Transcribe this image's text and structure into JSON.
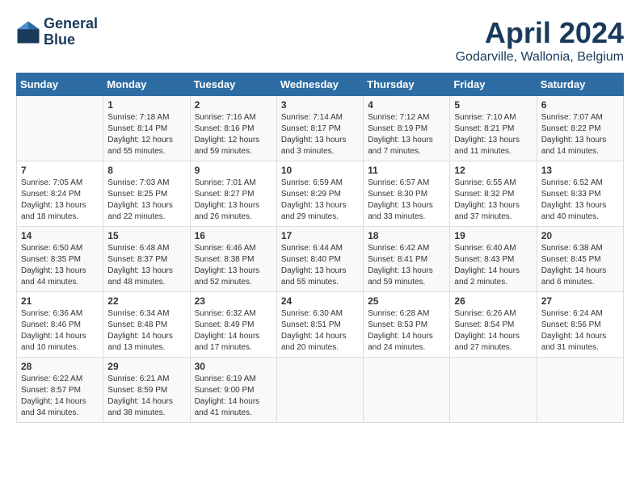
{
  "header": {
    "logo_line1": "General",
    "logo_line2": "Blue",
    "title": "April 2024",
    "subtitle": "Godarville, Wallonia, Belgium"
  },
  "days_of_week": [
    "Sunday",
    "Monday",
    "Tuesday",
    "Wednesday",
    "Thursday",
    "Friday",
    "Saturday"
  ],
  "weeks": [
    [
      {
        "day": "",
        "sunrise": "",
        "sunset": "",
        "daylight": ""
      },
      {
        "day": "1",
        "sunrise": "Sunrise: 7:18 AM",
        "sunset": "Sunset: 8:14 PM",
        "daylight": "Daylight: 12 hours and 55 minutes."
      },
      {
        "day": "2",
        "sunrise": "Sunrise: 7:16 AM",
        "sunset": "Sunset: 8:16 PM",
        "daylight": "Daylight: 12 hours and 59 minutes."
      },
      {
        "day": "3",
        "sunrise": "Sunrise: 7:14 AM",
        "sunset": "Sunset: 8:17 PM",
        "daylight": "Daylight: 13 hours and 3 minutes."
      },
      {
        "day": "4",
        "sunrise": "Sunrise: 7:12 AM",
        "sunset": "Sunset: 8:19 PM",
        "daylight": "Daylight: 13 hours and 7 minutes."
      },
      {
        "day": "5",
        "sunrise": "Sunrise: 7:10 AM",
        "sunset": "Sunset: 8:21 PM",
        "daylight": "Daylight: 13 hours and 11 minutes."
      },
      {
        "day": "6",
        "sunrise": "Sunrise: 7:07 AM",
        "sunset": "Sunset: 8:22 PM",
        "daylight": "Daylight: 13 hours and 14 minutes."
      }
    ],
    [
      {
        "day": "7",
        "sunrise": "Sunrise: 7:05 AM",
        "sunset": "Sunset: 8:24 PM",
        "daylight": "Daylight: 13 hours and 18 minutes."
      },
      {
        "day": "8",
        "sunrise": "Sunrise: 7:03 AM",
        "sunset": "Sunset: 8:25 PM",
        "daylight": "Daylight: 13 hours and 22 minutes."
      },
      {
        "day": "9",
        "sunrise": "Sunrise: 7:01 AM",
        "sunset": "Sunset: 8:27 PM",
        "daylight": "Daylight: 13 hours and 26 minutes."
      },
      {
        "day": "10",
        "sunrise": "Sunrise: 6:59 AM",
        "sunset": "Sunset: 8:29 PM",
        "daylight": "Daylight: 13 hours and 29 minutes."
      },
      {
        "day": "11",
        "sunrise": "Sunrise: 6:57 AM",
        "sunset": "Sunset: 8:30 PM",
        "daylight": "Daylight: 13 hours and 33 minutes."
      },
      {
        "day": "12",
        "sunrise": "Sunrise: 6:55 AM",
        "sunset": "Sunset: 8:32 PM",
        "daylight": "Daylight: 13 hours and 37 minutes."
      },
      {
        "day": "13",
        "sunrise": "Sunrise: 6:52 AM",
        "sunset": "Sunset: 8:33 PM",
        "daylight": "Daylight: 13 hours and 40 minutes."
      }
    ],
    [
      {
        "day": "14",
        "sunrise": "Sunrise: 6:50 AM",
        "sunset": "Sunset: 8:35 PM",
        "daylight": "Daylight: 13 hours and 44 minutes."
      },
      {
        "day": "15",
        "sunrise": "Sunrise: 6:48 AM",
        "sunset": "Sunset: 8:37 PM",
        "daylight": "Daylight: 13 hours and 48 minutes."
      },
      {
        "day": "16",
        "sunrise": "Sunrise: 6:46 AM",
        "sunset": "Sunset: 8:38 PM",
        "daylight": "Daylight: 13 hours and 52 minutes."
      },
      {
        "day": "17",
        "sunrise": "Sunrise: 6:44 AM",
        "sunset": "Sunset: 8:40 PM",
        "daylight": "Daylight: 13 hours and 55 minutes."
      },
      {
        "day": "18",
        "sunrise": "Sunrise: 6:42 AM",
        "sunset": "Sunset: 8:41 PM",
        "daylight": "Daylight: 13 hours and 59 minutes."
      },
      {
        "day": "19",
        "sunrise": "Sunrise: 6:40 AM",
        "sunset": "Sunset: 8:43 PM",
        "daylight": "Daylight: 14 hours and 2 minutes."
      },
      {
        "day": "20",
        "sunrise": "Sunrise: 6:38 AM",
        "sunset": "Sunset: 8:45 PM",
        "daylight": "Daylight: 14 hours and 6 minutes."
      }
    ],
    [
      {
        "day": "21",
        "sunrise": "Sunrise: 6:36 AM",
        "sunset": "Sunset: 8:46 PM",
        "daylight": "Daylight: 14 hours and 10 minutes."
      },
      {
        "day": "22",
        "sunrise": "Sunrise: 6:34 AM",
        "sunset": "Sunset: 8:48 PM",
        "daylight": "Daylight: 14 hours and 13 minutes."
      },
      {
        "day": "23",
        "sunrise": "Sunrise: 6:32 AM",
        "sunset": "Sunset: 8:49 PM",
        "daylight": "Daylight: 14 hours and 17 minutes."
      },
      {
        "day": "24",
        "sunrise": "Sunrise: 6:30 AM",
        "sunset": "Sunset: 8:51 PM",
        "daylight": "Daylight: 14 hours and 20 minutes."
      },
      {
        "day": "25",
        "sunrise": "Sunrise: 6:28 AM",
        "sunset": "Sunset: 8:53 PM",
        "daylight": "Daylight: 14 hours and 24 minutes."
      },
      {
        "day": "26",
        "sunrise": "Sunrise: 6:26 AM",
        "sunset": "Sunset: 8:54 PM",
        "daylight": "Daylight: 14 hours and 27 minutes."
      },
      {
        "day": "27",
        "sunrise": "Sunrise: 6:24 AM",
        "sunset": "Sunset: 8:56 PM",
        "daylight": "Daylight: 14 hours and 31 minutes."
      }
    ],
    [
      {
        "day": "28",
        "sunrise": "Sunrise: 6:22 AM",
        "sunset": "Sunset: 8:57 PM",
        "daylight": "Daylight: 14 hours and 34 minutes."
      },
      {
        "day": "29",
        "sunrise": "Sunrise: 6:21 AM",
        "sunset": "Sunset: 8:59 PM",
        "daylight": "Daylight: 14 hours and 38 minutes."
      },
      {
        "day": "30",
        "sunrise": "Sunrise: 6:19 AM",
        "sunset": "Sunset: 9:00 PM",
        "daylight": "Daylight: 14 hours and 41 minutes."
      },
      {
        "day": "",
        "sunrise": "",
        "sunset": "",
        "daylight": ""
      },
      {
        "day": "",
        "sunrise": "",
        "sunset": "",
        "daylight": ""
      },
      {
        "day": "",
        "sunrise": "",
        "sunset": "",
        "daylight": ""
      },
      {
        "day": "",
        "sunrise": "",
        "sunset": "",
        "daylight": ""
      }
    ]
  ]
}
